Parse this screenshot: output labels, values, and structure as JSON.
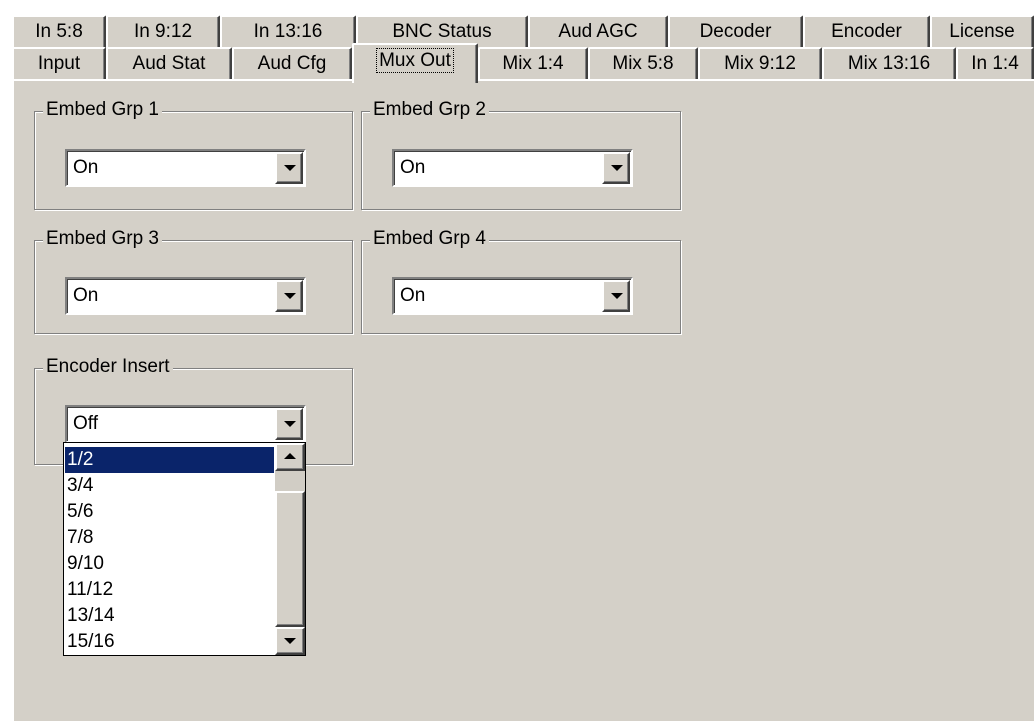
{
  "tabs_back_row": [
    {
      "label": "In 5:8"
    },
    {
      "label": "In 9:12"
    },
    {
      "label": "In 13:16"
    },
    {
      "label": "BNC Status"
    },
    {
      "label": "Aud AGC"
    },
    {
      "label": "Decoder"
    },
    {
      "label": "Encoder"
    },
    {
      "label": "License"
    }
  ],
  "tabs_front_row": [
    {
      "label": "Input"
    },
    {
      "label": "Aud Stat"
    },
    {
      "label": "Aud Cfg"
    },
    {
      "label": "Mux Out",
      "selected": true
    },
    {
      "label": "Mix 1:4"
    },
    {
      "label": "Mix 5:8"
    },
    {
      "label": "Mix 9:12"
    },
    {
      "label": "Mix 13:16"
    },
    {
      "label": "In 1:4"
    }
  ],
  "groups": {
    "embed_grp_1": {
      "label": "Embed Grp 1",
      "value": "On"
    },
    "embed_grp_2": {
      "label": "Embed Grp 2",
      "value": "On"
    },
    "embed_grp_3": {
      "label": "Embed Grp 3",
      "value": "On"
    },
    "embed_grp_4": {
      "label": "Embed Grp 4",
      "value": "On"
    },
    "encoder_insert": {
      "label": "Encoder Insert",
      "value": "Off"
    }
  },
  "encoder_insert_options": [
    {
      "label": "1/2",
      "highlighted": true
    },
    {
      "label": "3/4"
    },
    {
      "label": "5/6"
    },
    {
      "label": "7/8"
    },
    {
      "label": "9/10"
    },
    {
      "label": "11/12"
    },
    {
      "label": "13/14"
    },
    {
      "label": "15/16"
    }
  ],
  "colors": {
    "face": "#d4d0c8",
    "highlight": "#0a246a",
    "shadow": "#808080"
  },
  "icons": {
    "combo_arrow": "chevron-down-icon",
    "scroll_up": "arrow-up-icon",
    "scroll_down": "arrow-down-icon"
  }
}
